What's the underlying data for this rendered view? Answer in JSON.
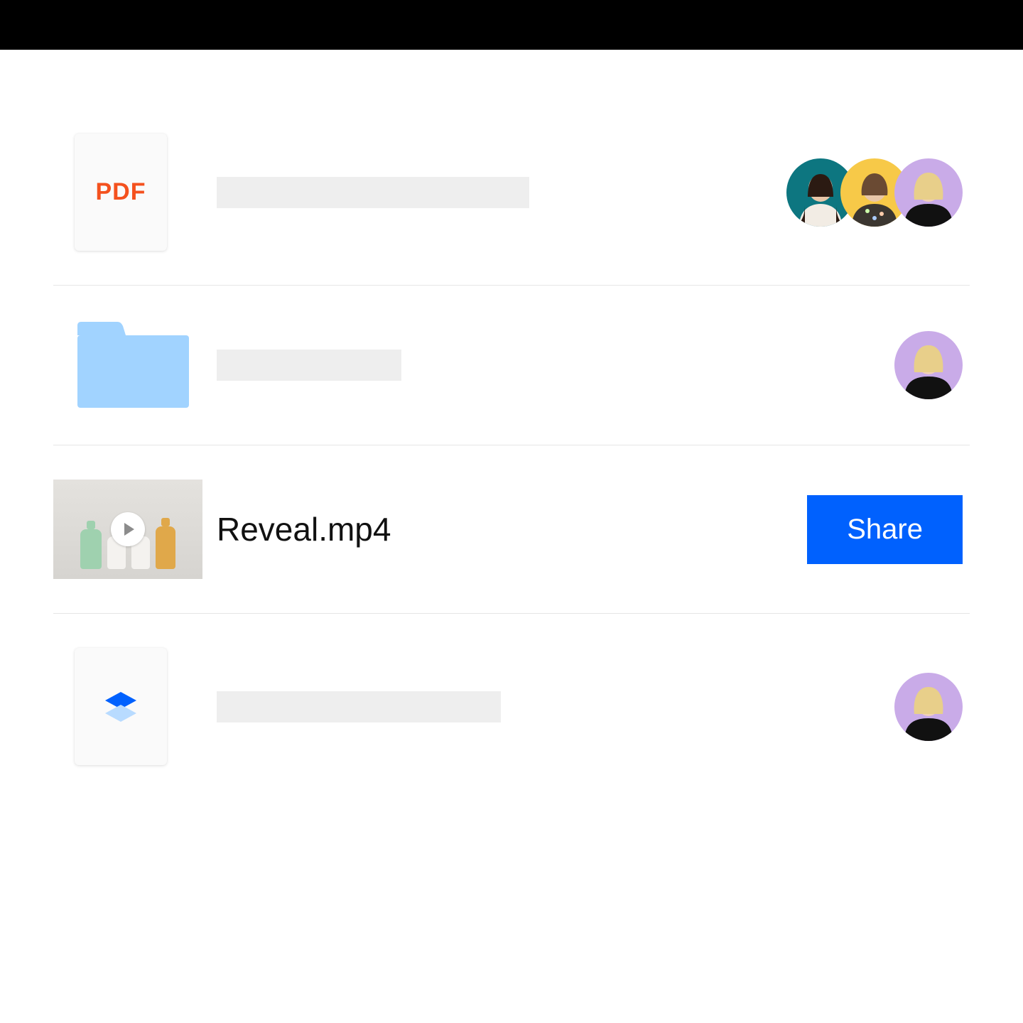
{
  "rows": [
    {
      "type": "pdf",
      "icon_label": "PDF",
      "name_placeholder": true,
      "avatars": [
        "teal",
        "yellow",
        "lilac"
      ]
    },
    {
      "type": "folder",
      "name_placeholder": true,
      "avatars": [
        "lilac"
      ]
    },
    {
      "type": "video",
      "name": "Reveal.mp4",
      "share_label": "Share"
    },
    {
      "type": "dropbox-file",
      "name_placeholder": true,
      "avatars": [
        "lilac"
      ]
    }
  ],
  "colors": {
    "share_button": "#0061fe",
    "pdf_label": "#f4511e",
    "folder": "#a1d3ff"
  }
}
